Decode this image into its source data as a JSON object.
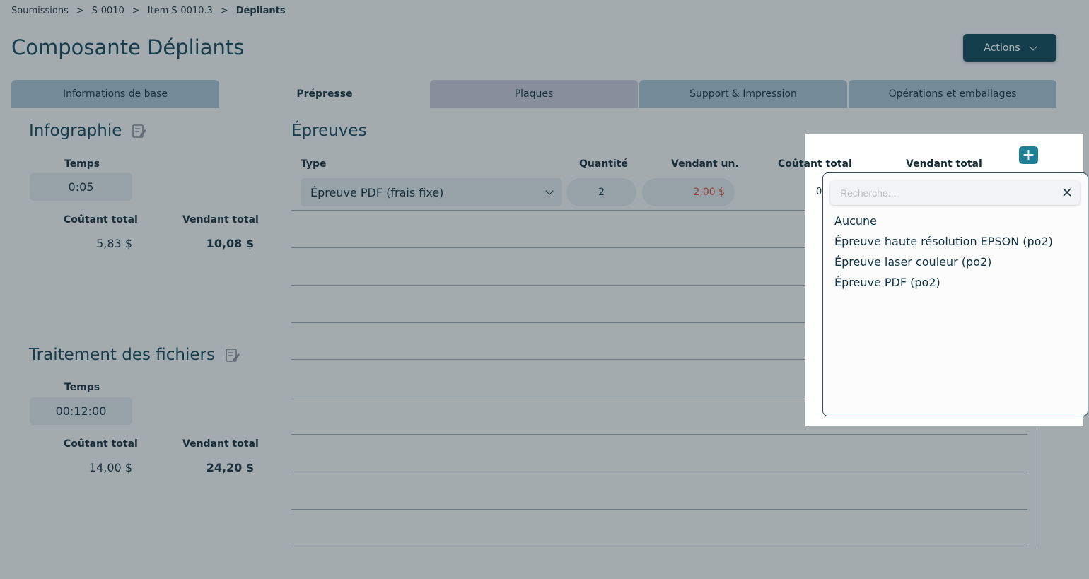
{
  "breadcrumb": [
    "Soumissions",
    "S-0010",
    "Item S-0010.3",
    "Dépliants"
  ],
  "breadcrumb_separator": ">",
  "page_title": "Composante Dépliants",
  "actions_label": "Actions",
  "tabs": [
    {
      "label": "Informations de base"
    },
    {
      "label": "Prépresse"
    },
    {
      "label": "Plaques"
    },
    {
      "label": "Support & Impression"
    },
    {
      "label": "Opérations et emballages"
    }
  ],
  "infographie": {
    "title": "Infographie",
    "temps_label": "Temps",
    "temps_value": "0:05",
    "cout_label": "Coûtant total",
    "cout_value": "5,83 $",
    "vend_label": "Vendant total",
    "vend_value": "10,08 $"
  },
  "traitement": {
    "title": "Traitement des fichiers",
    "temps_label": "Temps",
    "temps_value": "00:12:00",
    "cout_label": "Coûtant total",
    "cout_value": "14,00 $",
    "vend_label": "Vendant total",
    "vend_value": "24,20 $"
  },
  "epreuves": {
    "title": "Épreuves",
    "columns": {
      "type": "Type",
      "quantite": "Quantité",
      "vendant_un": "Vendant un.",
      "coutant_total": "Coûtant total",
      "vendant_total": "Vendant total"
    },
    "row": {
      "type": "Épreuve PDF (frais fixe)",
      "quantite": "2",
      "vendant_un": "2,00 $",
      "coutant_total": "0"
    },
    "add_label": "+"
  },
  "dropdown": {
    "search_placeholder": "Recherche...",
    "options": [
      "Aucune",
      "Épreuve haute résolution EPSON (po2)",
      "Épreuve laser couleur (po2)",
      "Épreuve PDF (po2)"
    ]
  },
  "colors": {
    "primary": "#0e4658",
    "accent": "#1f7f95",
    "price": "#e24b2b",
    "tab": "#a9c1cf"
  }
}
